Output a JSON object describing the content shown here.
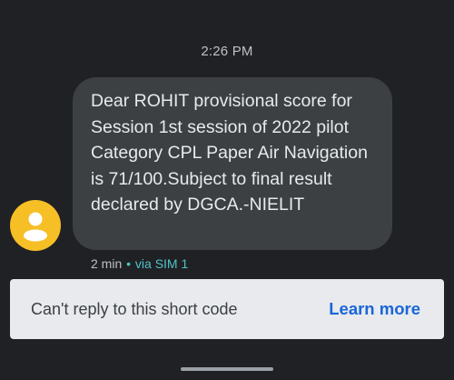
{
  "conversation": {
    "timestamp": "2:26 PM",
    "message": {
      "text": "Dear ROHIT provisional score for Session 1st session of 2022 pilot Category CPL Paper Air Navigation is 71/100.Subject to final result declared by DGCA.-NIELIT",
      "age": "2 min",
      "separator": "•",
      "via": "via SIM 1"
    },
    "sender_avatar_icon": "person-icon"
  },
  "reply_bar": {
    "notice": "Can't reply to this short code",
    "learn_more": "Learn more"
  },
  "colors": {
    "background": "#202124",
    "bubble": "#3c4043",
    "avatar": "#f6bf26",
    "accent_link": "#1a66d8",
    "sim_label": "#4fc3c8"
  }
}
